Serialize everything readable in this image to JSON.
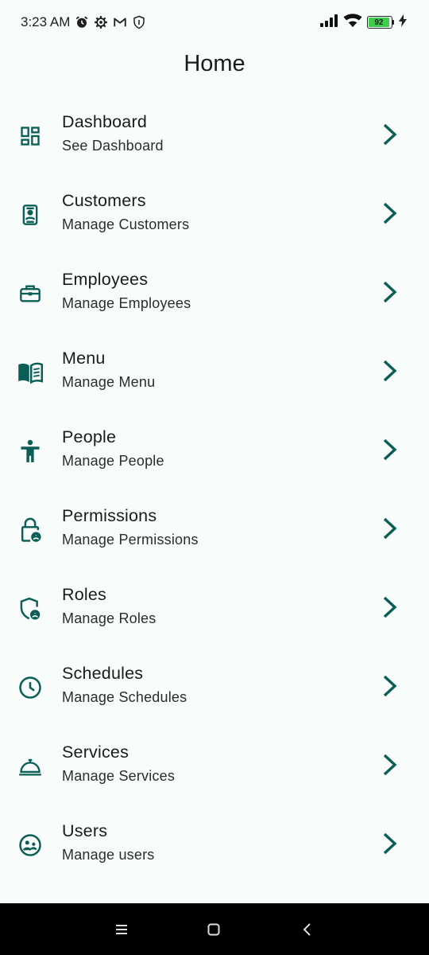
{
  "status_bar": {
    "time": "3:23 AM",
    "battery_level": "92",
    "left_icons": [
      "alarm-icon",
      "settings-icon",
      "gmail-icon",
      "vpn-shield-icon"
    ],
    "right_icons": [
      "signal-icon",
      "wifi-icon",
      "battery-icon",
      "charging-icon"
    ]
  },
  "app_bar": {
    "title": "Home"
  },
  "accent_color": "#0b5e55",
  "menu": [
    {
      "icon": "dashboard-icon",
      "title": "Dashboard",
      "subtitle": "See Dashboard"
    },
    {
      "icon": "customers-icon",
      "title": "Customers",
      "subtitle": "Manage Customers"
    },
    {
      "icon": "briefcase-icon",
      "title": "Employees",
      "subtitle": "Manage Employees"
    },
    {
      "icon": "menu-book-icon",
      "title": "Menu",
      "subtitle": "Manage Menu"
    },
    {
      "icon": "person-icon",
      "title": "People",
      "subtitle": "Manage People"
    },
    {
      "icon": "lock-person-icon",
      "title": "Permissions",
      "subtitle": "Manage Permissions"
    },
    {
      "icon": "shield-person-icon",
      "title": "Roles",
      "subtitle": "Manage Roles"
    },
    {
      "icon": "clock-icon",
      "title": "Schedules",
      "subtitle": "Manage Schedules"
    },
    {
      "icon": "room-service-icon",
      "title": "Services",
      "subtitle": "Manage Services"
    },
    {
      "icon": "users-face-icon",
      "title": "Users",
      "subtitle": "Manage users"
    }
  ],
  "nav_bar": {
    "icons": [
      "recents-icon",
      "home-icon",
      "back-icon"
    ]
  }
}
